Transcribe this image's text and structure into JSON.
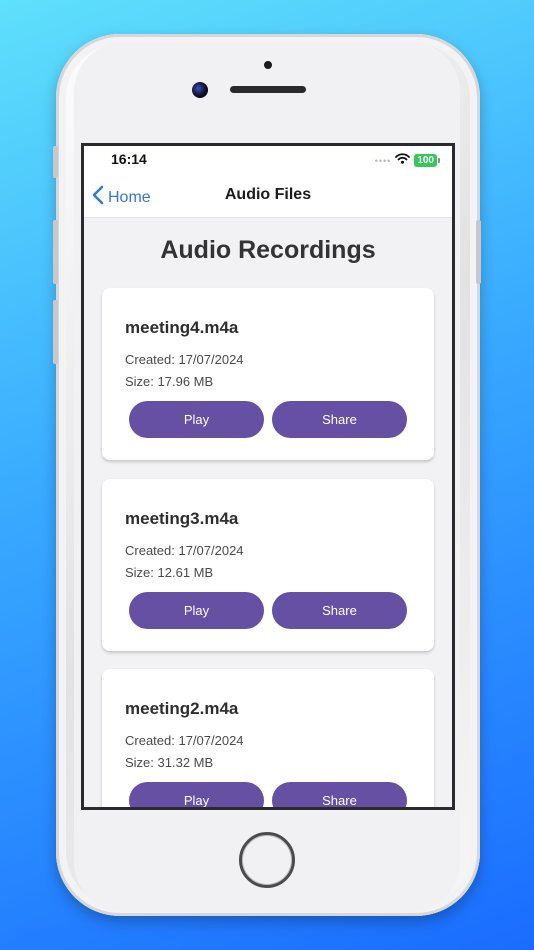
{
  "status": {
    "time": "16:14",
    "battery": "100",
    "signal_dots": "••••"
  },
  "nav": {
    "back_label": "Home",
    "title": "Audio Files"
  },
  "page": {
    "title": "Audio Recordings"
  },
  "recordings": [
    {
      "name": "meeting4.m4a",
      "created": "Created: 17/07/2024",
      "size": "Size: 17.96 MB",
      "play_label": "Play",
      "share_label": "Share"
    },
    {
      "name": "meeting3.m4a",
      "created": "Created: 17/07/2024",
      "size": "Size: 12.61 MB",
      "play_label": "Play",
      "share_label": "Share"
    },
    {
      "name": "meeting2.m4a",
      "created": "Created: 17/07/2024",
      "size": "Size: 31.32 MB",
      "play_label": "Play",
      "share_label": "Share"
    }
  ],
  "colors": {
    "background_top": "#5fe0fb",
    "background_bottom": "#1a6cff",
    "accent_button": "#6550a4",
    "link_blue": "#3479d8",
    "battery_green": "#35c759"
  },
  "icons": {
    "back": "chevron-left-icon",
    "wifi": "wifi-icon",
    "battery": "battery-icon"
  }
}
